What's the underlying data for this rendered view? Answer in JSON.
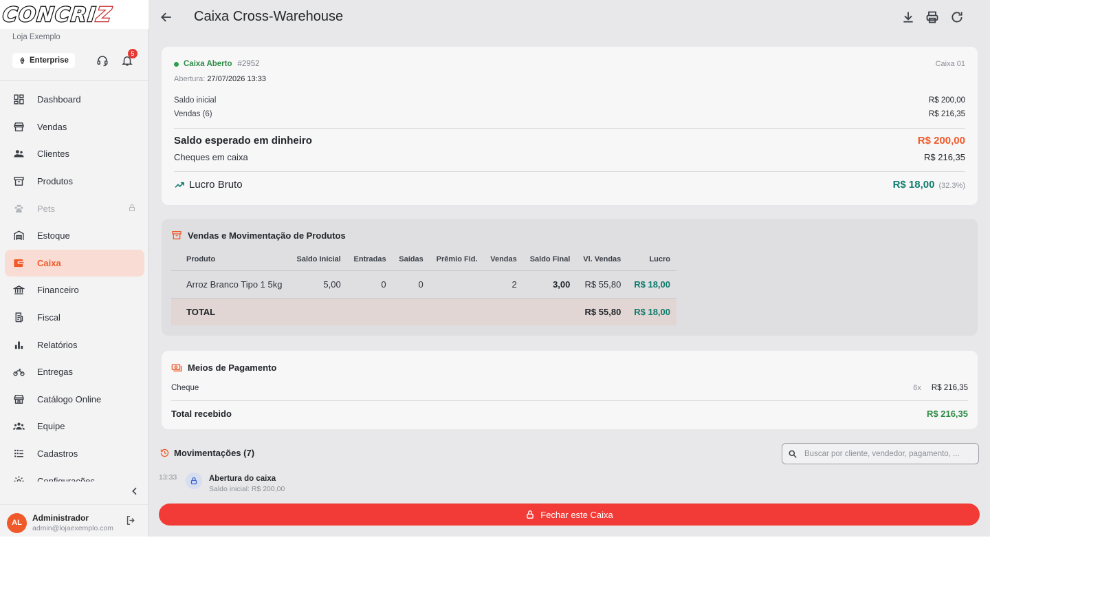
{
  "brand": {
    "logo_main": "CONCRI",
    "logo_tail": "Z"
  },
  "sidebar": {
    "store_name": "Loja Exemplo",
    "plan_label": "Enterprise",
    "notification_count": "5",
    "items": [
      {
        "label": "Dashboard",
        "icon": "dashboard-icon"
      },
      {
        "label": "Vendas",
        "icon": "storefront-icon"
      },
      {
        "label": "Clientes",
        "icon": "people-icon"
      },
      {
        "label": "Produtos",
        "icon": "archive-box-icon"
      },
      {
        "label": "Pets",
        "icon": "paw-icon",
        "disabled": true
      },
      {
        "label": "Estoque",
        "icon": "warehouse-icon"
      },
      {
        "label": "Caixa",
        "icon": "wallet-icon",
        "active": true
      },
      {
        "label": "Financeiro",
        "icon": "bank-icon"
      },
      {
        "label": "Fiscal",
        "icon": "receipt-icon"
      },
      {
        "label": "Relatórios",
        "icon": "bar-chart-icon"
      },
      {
        "label": "Entregas",
        "icon": "motorcycle-icon"
      },
      {
        "label": "Catálogo Online",
        "icon": "store-icon"
      },
      {
        "label": "Equipe",
        "icon": "team-icon"
      },
      {
        "label": "Cadastros",
        "icon": "grid-list-icon"
      },
      {
        "label": "Configurações",
        "icon": "gear-icon"
      }
    ],
    "user": {
      "initials": "AL",
      "name": "Administrador",
      "email": "admin@lojaexemplo.com"
    }
  },
  "header": {
    "title": "Caixa Cross-Warehouse"
  },
  "summary": {
    "status": "Caixa Aberto",
    "id": "#2952",
    "register": "Caixa 01",
    "opening_label": "Abertura:",
    "opening_value": "27/07/2026  13:33",
    "initial_label": "Saldo inicial",
    "initial_value": "R$ 200,00",
    "sales_label": "Vendas (6)",
    "sales_value": "R$ 216,35",
    "expected_label": "Saldo esperado em dinheiro",
    "expected_value": "R$ 200,00",
    "checks_label": "Cheques em caixa",
    "checks_value": "R$ 216,35",
    "profit_label": "Lucro Bruto",
    "profit_value": "R$ 18,00",
    "profit_pct": "(32.3%)"
  },
  "products": {
    "title": "Vendas e Movimentação de Produtos",
    "columns": [
      "Produto",
      "Saldo Inicial",
      "Entradas",
      "Saídas",
      "Prêmio Fid.",
      "Vendas",
      "Saldo Final",
      "Vl. Vendas",
      "Lucro"
    ],
    "rows": [
      {
        "product": "Arroz Branco Tipo 1 5kg",
        "initial": "5,00",
        "in": "0",
        "out": "0",
        "loyalty": "",
        "sales": "2",
        "final": "3,00",
        "value": "R$ 55,80",
        "profit": "R$ 18,00"
      }
    ],
    "total": {
      "label": "TOTAL",
      "value": "R$ 55,80",
      "profit": "R$ 18,00"
    }
  },
  "payments": {
    "title": "Meios de Pagamento",
    "method": "Cheque",
    "count": "6x",
    "amount": "R$ 216,35",
    "total_label": "Total recebido",
    "total_value": "R$ 216,35"
  },
  "movements": {
    "title": "Movimentações (7)",
    "search_placeholder": "Buscar por cliente, vendedor, pagamento, ...",
    "items": [
      {
        "time": "13:33",
        "title": "Abertura do caixa",
        "subtitle": "Saldo inicial: R$ 200,00"
      }
    ]
  },
  "close_button": "Fechar este Caixa",
  "colors": {
    "accent": "#f05a2a",
    "danger": "#f23b36",
    "success": "#2e8b45",
    "profit": "#0f7b6c"
  }
}
